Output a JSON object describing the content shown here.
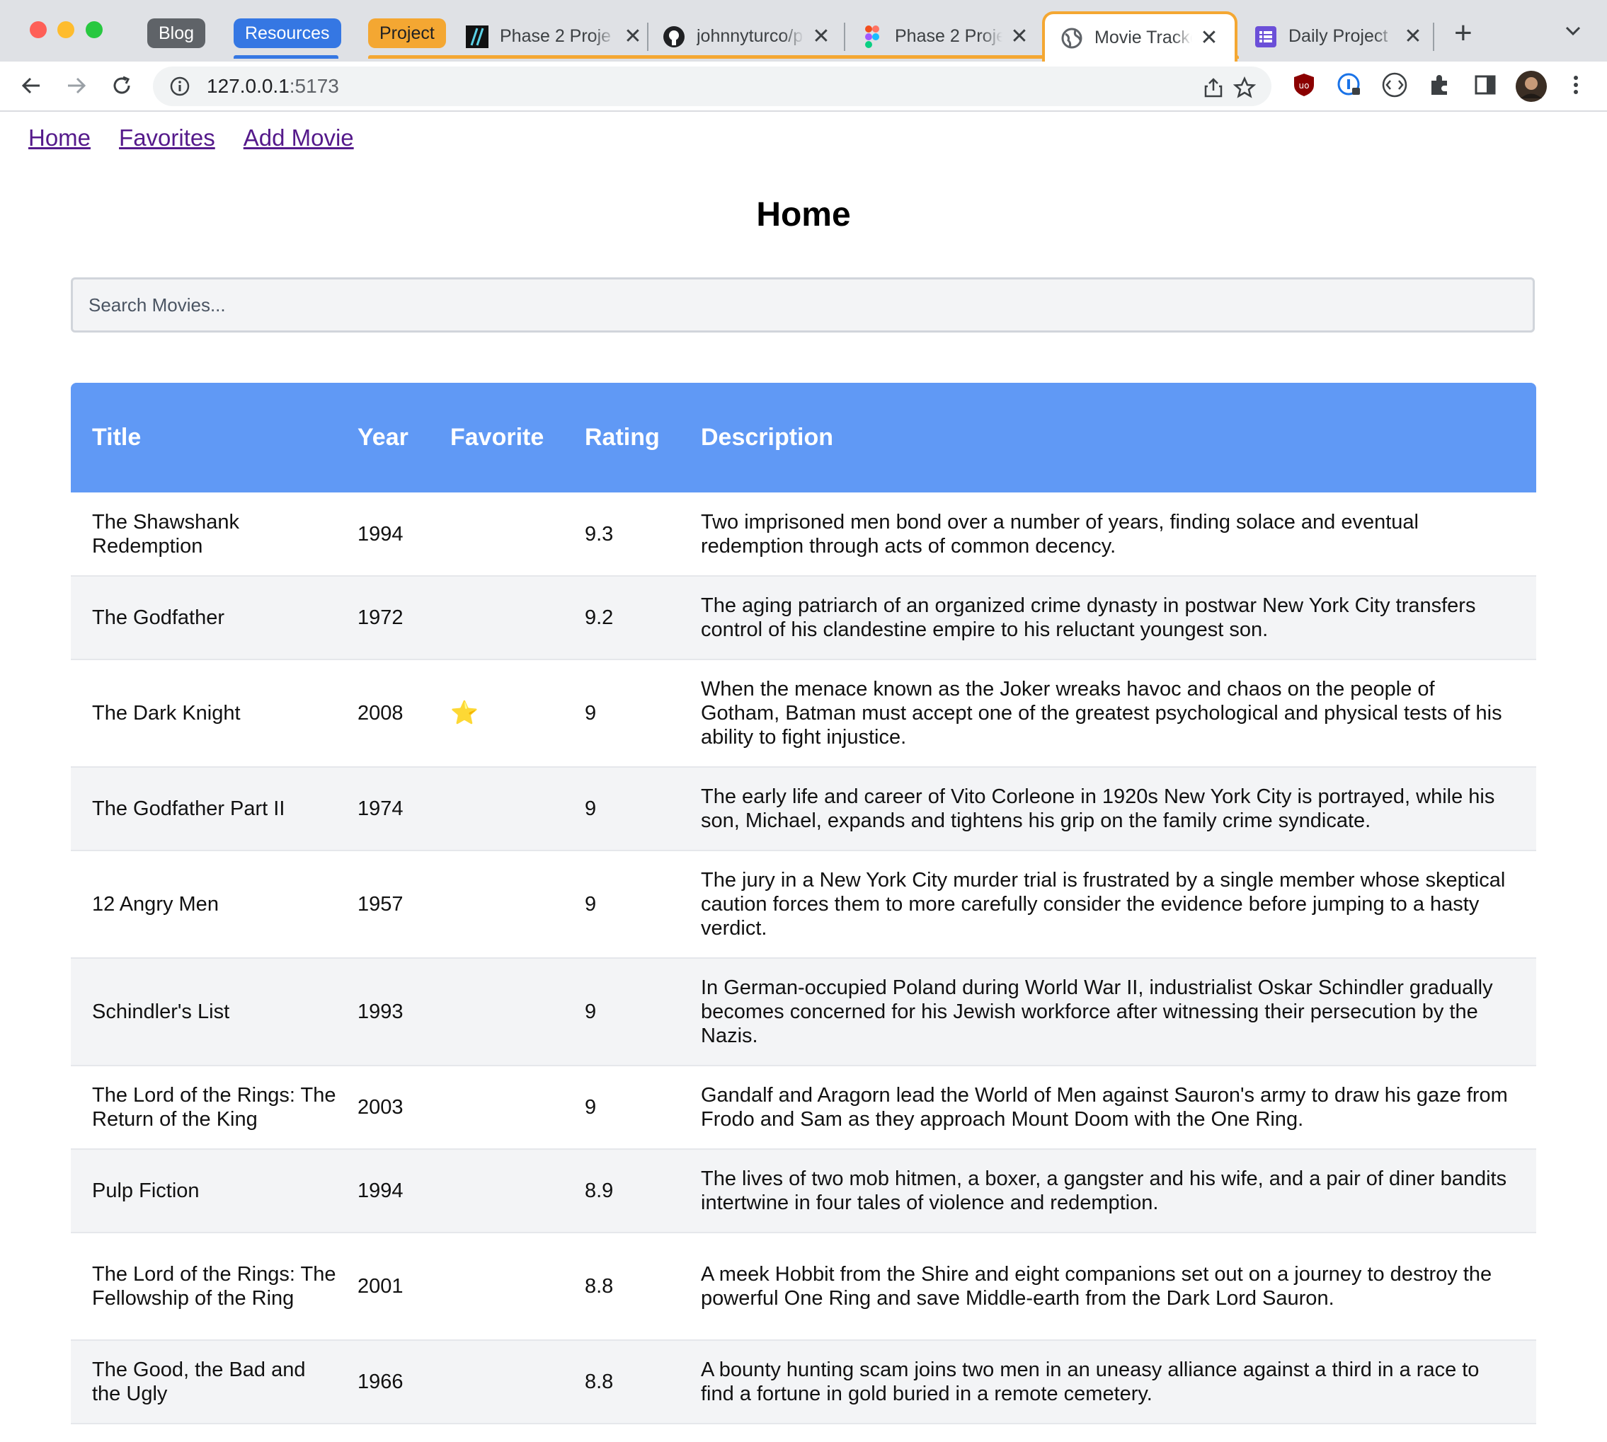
{
  "browser": {
    "groups": [
      {
        "label": "Blog",
        "color": "#5f6368"
      },
      {
        "label": "Resources",
        "color": "#3577e3"
      },
      {
        "label": "Project",
        "color": "#f4a732"
      }
    ],
    "tabs": [
      {
        "title": "Phase 2 Proje",
        "icon": "flatiron-icon"
      },
      {
        "title": "johnnyturco/p",
        "icon": "github-icon"
      },
      {
        "title": "Phase 2 Proje",
        "icon": "figma-icon"
      },
      {
        "title": "Movie Tracke",
        "icon": "globe-icon",
        "active": true
      },
      {
        "title": "Daily Project",
        "icon": "list-icon"
      }
    ],
    "new_tab": "+",
    "close_glyph": "✕",
    "url_host": "127.0.0.1",
    "url_port": ":5173"
  },
  "nav": {
    "links": [
      "Home",
      "Favorites",
      "Add Movie"
    ]
  },
  "page": {
    "title": "Home",
    "search_placeholder": "Search Movies..."
  },
  "table": {
    "headers": [
      "Title",
      "Year",
      "Favorite",
      "Rating",
      "Description"
    ],
    "rows": [
      {
        "title": "The Shawshank Redemption",
        "year": "1994",
        "favorite": "",
        "rating": "9.3",
        "description": "Two imprisoned men bond over a number of years, finding solace and eventual redemption through acts of common decency."
      },
      {
        "title": "The Godfather",
        "year": "1972",
        "favorite": "",
        "rating": "9.2",
        "description": "The aging patriarch of an organized crime dynasty in postwar New York City transfers control of his clandestine empire to his reluctant youngest son."
      },
      {
        "title": "The Dark Knight",
        "year": "2008",
        "favorite": "⭐",
        "rating": "9",
        "description": "When the menace known as the Joker wreaks havoc and chaos on the people of Gotham, Batman must accept one of the greatest psychological and physical tests of his ability to fight injustice."
      },
      {
        "title": "The Godfather Part II",
        "year": "1974",
        "favorite": "",
        "rating": "9",
        "description": "The early life and career of Vito Corleone in 1920s New York City is portrayed, while his son, Michael, expands and tightens his grip on the family crime syndicate."
      },
      {
        "title": "12 Angry Men",
        "year": "1957",
        "favorite": "",
        "rating": "9",
        "description": "The jury in a New York City murder trial is frustrated by a single member whose skeptical caution forces them to more carefully consider the evidence before jumping to a hasty verdict."
      },
      {
        "title": "Schindler's List",
        "year": "1993",
        "favorite": "",
        "rating": "9",
        "description": "In German-occupied Poland during World War II, industrialist Oskar Schindler gradually becomes concerned for his Jewish workforce after witnessing their persecution by the Nazis."
      },
      {
        "title": "The Lord of the Rings: The Return of the King",
        "year": "2003",
        "favorite": "",
        "rating": "9",
        "description": "Gandalf and Aragorn lead the World of Men against Sauron's army to draw his gaze from Frodo and Sam as they approach Mount Doom with the One Ring."
      },
      {
        "title": "Pulp Fiction",
        "year": "1994",
        "favorite": "",
        "rating": "8.9",
        "description": "The lives of two mob hitmen, a boxer, a gangster and his wife, and a pair of diner bandits intertwine in four tales of violence and redemption."
      },
      {
        "title": "The Lord of the Rings: The Fellowship of the Ring",
        "year": "2001",
        "favorite": "",
        "rating": "8.8",
        "description": "A meek Hobbit from the Shire and eight companions set out on a journey to destroy the powerful One Ring and save Middle-earth from the Dark Lord Sauron."
      },
      {
        "title": "The Good, the Bad and the Ugly",
        "year": "1966",
        "favorite": "",
        "rating": "8.8",
        "description": "A bounty hunting scam joins two men in an uneasy alliance against a third in a race to find a fortune in gold buried in a remote cemetery."
      }
    ]
  }
}
